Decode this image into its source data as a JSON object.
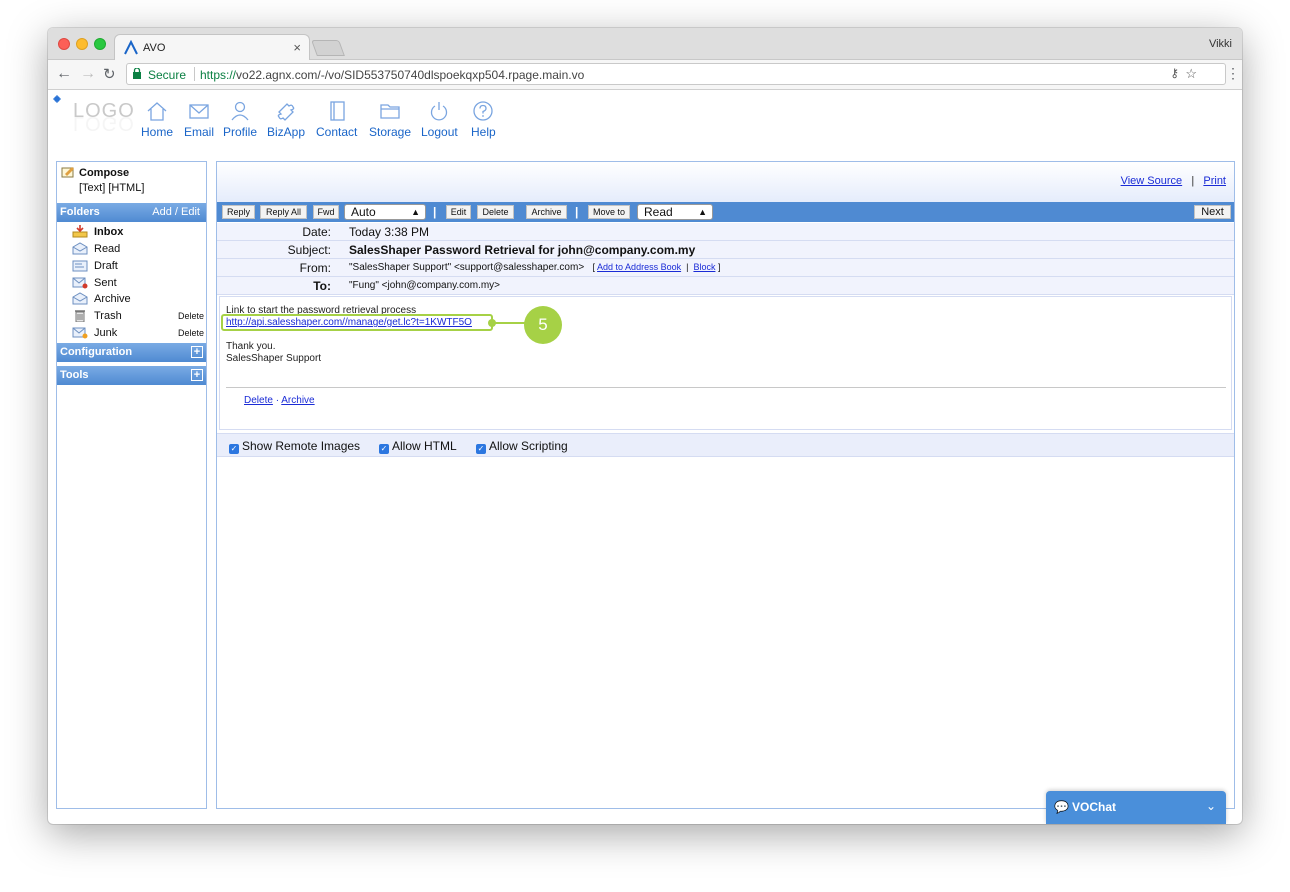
{
  "browser": {
    "tab_title": "AVO",
    "profile_name": "Vikki",
    "secure_label": "Secure",
    "url_scheme": "https://",
    "url_rest": "vo22.agnx.com/-/vo/SID553750740dlspoekqxp504.rpage.main.vo"
  },
  "logo_text": "LOGO",
  "nav": {
    "items": [
      {
        "label": "Home",
        "icon": "home-icon"
      },
      {
        "label": "Email",
        "icon": "envelope-icon"
      },
      {
        "label": "Profile",
        "icon": "person-icon"
      },
      {
        "label": "BizApp",
        "icon": "puzzle-icon"
      },
      {
        "label": "Contact",
        "icon": "address-book-icon"
      },
      {
        "label": "Storage",
        "icon": "folder-icon"
      },
      {
        "label": "Logout",
        "icon": "power-icon"
      },
      {
        "label": "Help",
        "icon": "question-icon"
      }
    ]
  },
  "sidebar": {
    "compose_label": "Compose",
    "compose_modes": "[Text] [HTML]",
    "folders_label": "Folders",
    "add_edit_label": "Add / Edit",
    "folders": [
      {
        "name": "Inbox",
        "bold": true,
        "delete": ""
      },
      {
        "name": "Read",
        "delete": ""
      },
      {
        "name": "Draft",
        "delete": ""
      },
      {
        "name": "Sent",
        "delete": ""
      },
      {
        "name": "Archive",
        "delete": ""
      },
      {
        "name": "Trash",
        "delete": "Delete"
      },
      {
        "name": "Junk",
        "delete": "Delete"
      }
    ],
    "configuration_label": "Configuration",
    "tools_label": "Tools"
  },
  "message": {
    "view_source_label": "View Source",
    "print_label": "Print",
    "toolbar": {
      "reply": "Reply",
      "reply_all": "Reply All",
      "fwd": "Fwd",
      "auto_select": "Auto",
      "edit": "Edit",
      "delete": "Delete",
      "archive": "Archive",
      "move_to": "Move to",
      "move_select": "Read",
      "next": "Next"
    },
    "headers": {
      "date_label": "Date:",
      "date_value": "Today 3:38 PM",
      "subject_label": "Subject:",
      "subject_value": "SalesShaper Password Retrieval for john@company.com.my",
      "from_label": "From:",
      "from_value": "\"SalesShaper Support\" <support@salesshaper.com>",
      "add_to_address_book": "Add to Address Book",
      "block": "Block",
      "to_label": "To:",
      "to_value": "\"Fung\" <john@company.com.my>"
    },
    "body": {
      "line1": "Link to start the password retrieval process",
      "link": "http://api.salesshaper.com//manage/get.lc?t=1KWTF5O",
      "line3": "Thank you.",
      "line4": "SalesShaper Support",
      "footer_delete": "Delete",
      "footer_sep": "·",
      "footer_archive": "Archive"
    },
    "callout_number": "5",
    "options": {
      "remote_images": "Show Remote Images",
      "allow_html": "Allow HTML",
      "allow_scripting": "Allow Scripting"
    }
  },
  "chat": {
    "label": "VOChat"
  },
  "colors": {
    "accent_blue": "#4f8ad2",
    "link_blue": "#1a2bd6",
    "callout_green": "#a6d146"
  }
}
